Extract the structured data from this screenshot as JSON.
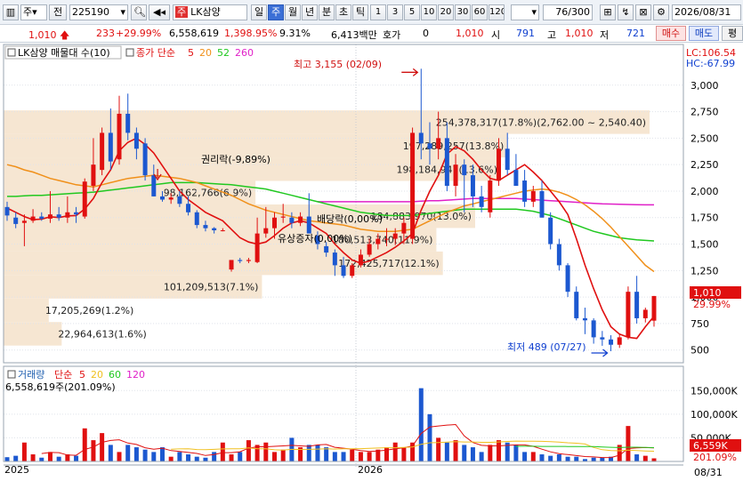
{
  "toolbar": {
    "panel_icon": "window-layout-icon",
    "mode_select": "주",
    "prev_label": "전",
    "code_value": "225190",
    "stock_badge": "주",
    "stock_name": "LK삼양",
    "period_tabs": [
      "일",
      "주",
      "월",
      "년",
      "분",
      "초",
      "틱"
    ],
    "active_period": "주",
    "interval_buttons": [
      "1",
      "3",
      "5",
      "10",
      "20",
      "30",
      "60",
      "120"
    ],
    "count_value": "76",
    "count_total": "/300",
    "date_value": "2026/08/31"
  },
  "quote": {
    "price": "1,010",
    "change": "233",
    "change_pct": "+29.99%",
    "volume": "6,558,619",
    "volume_ratio": "1,398.95%",
    "turnover": "9.31%",
    "amount": "6,413백만",
    "bid_label": "호가",
    "bid_value": "0",
    "ask_value": "1,010",
    "open_label": "시",
    "open_value": "791",
    "high_label": "고",
    "high_value": "1,010",
    "low_label": "저",
    "low_value": "721",
    "buy_label": "매수",
    "sell_label": "매도",
    "avg_label": "평"
  },
  "price_panel": {
    "series_label": "LK삼양 매물대 수(10)",
    "ma_title": "종가 단순",
    "ma_periods": [
      "5",
      "20",
      "52",
      "260"
    ],
    "ma_colors": [
      "#e01010",
      "#f0901a",
      "#20c820",
      "#e020c8"
    ],
    "lc_label": "LC:106.54",
    "hc_label": "HC:-67.99",
    "high_note": "최고 3,155 (02/09)",
    "low_note": "최저 489 (07/27)",
    "rights_note": "권리락(-9,89%)",
    "dividend_note": "배당락(0,00%)",
    "paidin_note": "유상증자(0,00%)",
    "current_price_tag": "1,010",
    "current_pct_tag": "29.99%",
    "y_ticks": [
      "3,000",
      "2,750",
      "2,500",
      "2,250",
      "2,000",
      "1,750",
      "1,500",
      "1,250",
      "1,000",
      "750",
      "500"
    ]
  },
  "volume_profile": [
    {
      "label": "254,378,317(17.8%)(2,762.00 ~ 2,540.40)",
      "y0": 2540,
      "y1": 2762,
      "len": 1.0
    },
    {
      "label": "197,289,257(13.8%)",
      "y0": 2318,
      "y1": 2540,
      "len": 0.78
    },
    {
      "label": "198,184,947(13.6%)",
      "y0": 2096,
      "y1": 2318,
      "len": 0.77
    },
    {
      "label": "98,162,766(6.9%)",
      "y0": 1874,
      "y1": 2096,
      "len": 0.39
    },
    {
      "label": "184,883,970(13.0%)",
      "y0": 1652,
      "y1": 1874,
      "len": 0.73
    },
    {
      "label": "180,513,740(11.9%)",
      "y0": 1430,
      "y1": 1652,
      "len": 0.67
    },
    {
      "label": "172,425,717(12.1%)",
      "y0": 1208,
      "y1": 1430,
      "len": 0.68
    },
    {
      "label": "101,209,513(7.1%)",
      "y0": 986,
      "y1": 1208,
      "len": 0.4
    },
    {
      "label": "17,205,269(1.2%)",
      "y0": 764,
      "y1": 986,
      "len": 0.07
    },
    {
      "label": "22,964,613(1.6%)",
      "y0": 542,
      "y1": 764,
      "len": 0.09
    }
  ],
  "volume_panel": {
    "title": "거래량",
    "ma_title": "단순",
    "ma_periods": [
      "5",
      "20",
      "60",
      "120"
    ],
    "ma_colors": [
      "#e01010",
      "#f0c020",
      "#20c820",
      "#e020c8"
    ],
    "last_volume": "6,558,619주(201.09%)",
    "y_ticks": [
      "150,000K",
      "100,000K",
      "50,000K"
    ],
    "current_tag": "6,559K",
    "current_pct_tag": "201.09%"
  },
  "x_axis": {
    "labels": [
      "2025",
      "2026"
    ],
    "last_date": "08/31"
  },
  "chart_data": {
    "type": "candlestick",
    "y_axis_range": [
      380,
      3250
    ],
    "volume_axis_range": [
      0,
      175000
    ],
    "volume_unit": "K shares",
    "annotations": [
      "최고 3,155 (02/09)",
      "최저 489 (07/27)",
      "권리락(-9,89%)",
      "배당락(0,00%)",
      "유상증자(0,00%)"
    ],
    "candles": [
      {
        "o": 1850,
        "h": 1900,
        "l": 1720,
        "c": 1770
      },
      {
        "o": 1750,
        "h": 1800,
        "l": 1650,
        "c": 1690
      },
      {
        "o": 1700,
        "h": 1780,
        "l": 1480,
        "c": 1720
      },
      {
        "o": 1720,
        "h": 1830,
        "l": 1700,
        "c": 1760
      },
      {
        "o": 1760,
        "h": 1800,
        "l": 1720,
        "c": 1740
      },
      {
        "o": 1740,
        "h": 2000,
        "l": 1700,
        "c": 1780
      },
      {
        "o": 1780,
        "h": 1850,
        "l": 1720,
        "c": 1750
      },
      {
        "o": 1750,
        "h": 1950,
        "l": 1700,
        "c": 1800
      },
      {
        "o": 1800,
        "h": 1850,
        "l": 1700,
        "c": 1780
      },
      {
        "o": 1760,
        "h": 2120,
        "l": 1740,
        "c": 2090
      },
      {
        "o": 2050,
        "h": 2500,
        "l": 2000,
        "c": 2250
      },
      {
        "o": 2200,
        "h": 2600,
        "l": 2150,
        "c": 2550
      },
      {
        "o": 2550,
        "h": 2780,
        "l": 2200,
        "c": 2280
      },
      {
        "o": 2300,
        "h": 2900,
        "l": 2250,
        "c": 2730
      },
      {
        "o": 2730,
        "h": 2920,
        "l": 2480,
        "c": 2550
      },
      {
        "o": 2550,
        "h": 2600,
        "l": 2300,
        "c": 2400
      },
      {
        "o": 2450,
        "h": 2500,
        "l": 2100,
        "c": 2150
      },
      {
        "o": 2150,
        "h": 2250,
        "l": 1950,
        "c": 1950
      },
      {
        "o": 1950,
        "h": 2000,
        "l": 1900,
        "c": 1920
      },
      {
        "o": 1920,
        "h": 1980,
        "l": 1880,
        "c": 1940
      },
      {
        "o": 1950,
        "h": 2000,
        "l": 1850,
        "c": 1880
      },
      {
        "o": 1880,
        "h": 1950,
        "l": 1770,
        "c": 1800
      },
      {
        "o": 1800,
        "h": 1820,
        "l": 1650,
        "c": 1680
      },
      {
        "o": 1680,
        "h": 1720,
        "l": 1620,
        "c": 1650
      },
      {
        "o": 1650,
        "h": 1660,
        "l": 1600,
        "c": 1630
      },
      {
        "o": 1630,
        "h": 1650,
        "l": 1620,
        "c": 1630
      },
      {
        "o": 1260,
        "h": 1340,
        "l": 1240,
        "c": 1350
      },
      {
        "o": 1350,
        "h": 1370,
        "l": 1320,
        "c": 1340
      },
      {
        "o": 1340,
        "h": 1370,
        "l": 1320,
        "c": 1350
      },
      {
        "o": 1330,
        "h": 1750,
        "l": 1320,
        "c": 1600
      },
      {
        "o": 1600,
        "h": 1850,
        "l": 1560,
        "c": 1650
      },
      {
        "o": 1650,
        "h": 1800,
        "l": 1550,
        "c": 1750
      },
      {
        "o": 1750,
        "h": 1880,
        "l": 1700,
        "c": 1760
      },
      {
        "o": 1750,
        "h": 1800,
        "l": 1650,
        "c": 1700
      },
      {
        "o": 1700,
        "h": 1800,
        "l": 1670,
        "c": 1760
      },
      {
        "o": 1760,
        "h": 1980,
        "l": 1600,
        "c": 1600
      },
      {
        "o": 1580,
        "h": 1620,
        "l": 1450,
        "c": 1500
      },
      {
        "o": 1480,
        "h": 1520,
        "l": 1380,
        "c": 1420
      },
      {
        "o": 1420,
        "h": 1450,
        "l": 1200,
        "c": 1300
      },
      {
        "o": 1300,
        "h": 1380,
        "l": 1180,
        "c": 1200
      },
      {
        "o": 1200,
        "h": 1320,
        "l": 1180,
        "c": 1300
      },
      {
        "o": 1300,
        "h": 1450,
        "l": 1280,
        "c": 1400
      },
      {
        "o": 1400,
        "h": 1550,
        "l": 1380,
        "c": 1500
      },
      {
        "o": 1500,
        "h": 1600,
        "l": 1450,
        "c": 1550
      },
      {
        "o": 1550,
        "h": 1650,
        "l": 1480,
        "c": 1550
      },
      {
        "o": 1550,
        "h": 1650,
        "l": 1490,
        "c": 1600
      },
      {
        "o": 1600,
        "h": 1750,
        "l": 1500,
        "c": 1700
      },
      {
        "o": 1550,
        "h": 2600,
        "l": 1500,
        "c": 2550
      },
      {
        "o": 2550,
        "h": 3155,
        "l": 2300,
        "c": 2450
      },
      {
        "o": 2450,
        "h": 2650,
        "l": 2250,
        "c": 2400
      },
      {
        "o": 2400,
        "h": 2750,
        "l": 2300,
        "c": 2500
      },
      {
        "o": 2500,
        "h": 2650,
        "l": 2000,
        "c": 2050
      },
      {
        "o": 2050,
        "h": 2350,
        "l": 1950,
        "c": 2250
      },
      {
        "o": 2250,
        "h": 2300,
        "l": 1800,
        "c": 2150
      },
      {
        "o": 2150,
        "h": 2250,
        "l": 1850,
        "c": 1950
      },
      {
        "o": 1950,
        "h": 2050,
        "l": 1800,
        "c": 1850
      },
      {
        "o": 1800,
        "h": 2150,
        "l": 1750,
        "c": 2100
      },
      {
        "o": 2100,
        "h": 2500,
        "l": 2050,
        "c": 2400
      },
      {
        "o": 2400,
        "h": 2550,
        "l": 2150,
        "c": 2200
      },
      {
        "o": 2200,
        "h": 2350,
        "l": 2050,
        "c": 2050
      },
      {
        "o": 2100,
        "h": 2200,
        "l": 1850,
        "c": 1900
      },
      {
        "o": 1900,
        "h": 2050,
        "l": 1850,
        "c": 2000
      },
      {
        "o": 2000,
        "h": 2100,
        "l": 1750,
        "c": 1750
      },
      {
        "o": 1750,
        "h": 1800,
        "l": 1450,
        "c": 1500
      },
      {
        "o": 1500,
        "h": 1550,
        "l": 1250,
        "c": 1300
      },
      {
        "o": 1300,
        "h": 1320,
        "l": 1000,
        "c": 1050
      },
      {
        "o": 1050,
        "h": 1100,
        "l": 780,
        "c": 800
      },
      {
        "o": 800,
        "h": 900,
        "l": 650,
        "c": 780
      },
      {
        "o": 780,
        "h": 800,
        "l": 560,
        "c": 620
      },
      {
        "o": 620,
        "h": 680,
        "l": 540,
        "c": 600
      },
      {
        "o": 600,
        "h": 640,
        "l": 489,
        "c": 550
      },
      {
        "o": 550,
        "h": 650,
        "l": 520,
        "c": 620
      },
      {
        "o": 620,
        "h": 1100,
        "l": 600,
        "c": 1050
      },
      {
        "o": 1050,
        "h": 1200,
        "l": 750,
        "c": 800
      },
      {
        "o": 800,
        "h": 900,
        "l": 760,
        "c": 880
      },
      {
        "o": 777,
        "h": 1010,
        "l": 721,
        "c": 1010
      }
    ],
    "volume": [
      9000,
      12000,
      40000,
      15000,
      8000,
      20000,
      10000,
      15000,
      12000,
      70000,
      45000,
      60000,
      35000,
      20000,
      35000,
      30000,
      25000,
      20000,
      30000,
      10000,
      20000,
      15000,
      10000,
      8000,
      20000,
      40000,
      15000,
      20000,
      45000,
      35000,
      40000,
      20000,
      25000,
      50000,
      30000,
      35000,
      35000,
      30000,
      20000,
      20000,
      25000,
      20000,
      20000,
      25000,
      30000,
      40000,
      30000,
      40000,
      155000,
      100000,
      50000,
      40000,
      45000,
      35000,
      30000,
      20000,
      35000,
      45000,
      40000,
      35000,
      20000,
      20000,
      15000,
      12000,
      15000,
      10000,
      10000,
      5000,
      8000,
      8000,
      10000,
      35000,
      75000,
      15000,
      12000,
      6559
    ],
    "ma5": [
      1840,
      1800,
      1760,
      1730,
      1736,
      1758,
      1750,
      1766,
      1770,
      1830,
      1930,
      2080,
      2200,
      2380,
      2460,
      2500,
      2440,
      2360,
      2240,
      2120,
      2000,
      1920,
      1860,
      1800,
      1760,
      1720,
      1640,
      1560,
      1520,
      1500,
      1520,
      1580,
      1650,
      1700,
      1720,
      1700,
      1650,
      1600,
      1500,
      1420,
      1350,
      1320,
      1340,
      1380,
      1420,
      1470,
      1530,
      1600,
      1820,
      2000,
      2150,
      2350,
      2420,
      2380,
      2300,
      2200,
      2120,
      2100,
      2150,
      2200,
      2250,
      2180,
      2100,
      2000,
      1900,
      1780,
      1550,
      1300,
      1080,
      880,
      720,
      650,
      620,
      610,
      720,
      820
    ],
    "ma20": [
      2250,
      2230,
      2200,
      2180,
      2150,
      2120,
      2100,
      2080,
      2060,
      2050,
      2040,
      2060,
      2080,
      2100,
      2120,
      2130,
      2140,
      2150,
      2140,
      2130,
      2120,
      2100,
      2080,
      2050,
      2020,
      1990,
      1960,
      1920,
      1880,
      1850,
      1820,
      1800,
      1780,
      1760,
      1740,
      1720,
      1710,
      1700,
      1690,
      1680,
      1660,
      1640,
      1630,
      1620,
      1620,
      1620,
      1630,
      1640,
      1680,
      1720,
      1760,
      1800,
      1830,
      1860,
      1880,
      1900,
      1920,
      1940,
      1960,
      1980,
      2000,
      2010,
      2020,
      2010,
      1990,
      1960,
      1920,
      1870,
      1810,
      1740,
      1660,
      1570,
      1480,
      1390,
      1300,
      1240
    ],
    "ma52": [
      1950,
      1950,
      1955,
      1960,
      1960,
      1965,
      1970,
      1975,
      1980,
      1985,
      1990,
      2000,
      2010,
      2020,
      2030,
      2040,
      2050,
      2060,
      2070,
      2080,
      2080,
      2080,
      2080,
      2075,
      2070,
      2065,
      2060,
      2050,
      2040,
      2030,
      2020,
      2000,
      1980,
      1960,
      1940,
      1920,
      1900,
      1880,
      1860,
      1840,
      1820,
      1800,
      1790,
      1780,
      1770,
      1770,
      1770,
      1770,
      1780,
      1790,
      1800,
      1810,
      1820,
      1830,
      1830,
      1830,
      1830,
      1830,
      1830,
      1830,
      1820,
      1810,
      1790,
      1770,
      1740,
      1710,
      1680,
      1650,
      1620,
      1600,
      1580,
      1560,
      1550,
      1540,
      1535,
      1530
    ],
    "ma260": [
      null,
      null,
      null,
      null,
      null,
      null,
      null,
      null,
      null,
      null,
      null,
      null,
      null,
      null,
      null,
      null,
      null,
      null,
      null,
      null,
      null,
      null,
      null,
      null,
      null,
      null,
      null,
      null,
      null,
      null,
      null,
      null,
      null,
      null,
      null,
      null,
      1900,
      1900,
      1900,
      1900,
      1900,
      1900,
      1900,
      1900,
      1900,
      1900,
      1900,
      1900,
      1905,
      1910,
      1910,
      1915,
      1920,
      1925,
      1930,
      1930,
      1930,
      1930,
      1930,
      1930,
      1925,
      1920,
      1915,
      1910,
      1905,
      1900,
      1895,
      1890,
      1885,
      1880,
      1878,
      1876,
      1874,
      1872,
      1870,
      1870
    ]
  }
}
